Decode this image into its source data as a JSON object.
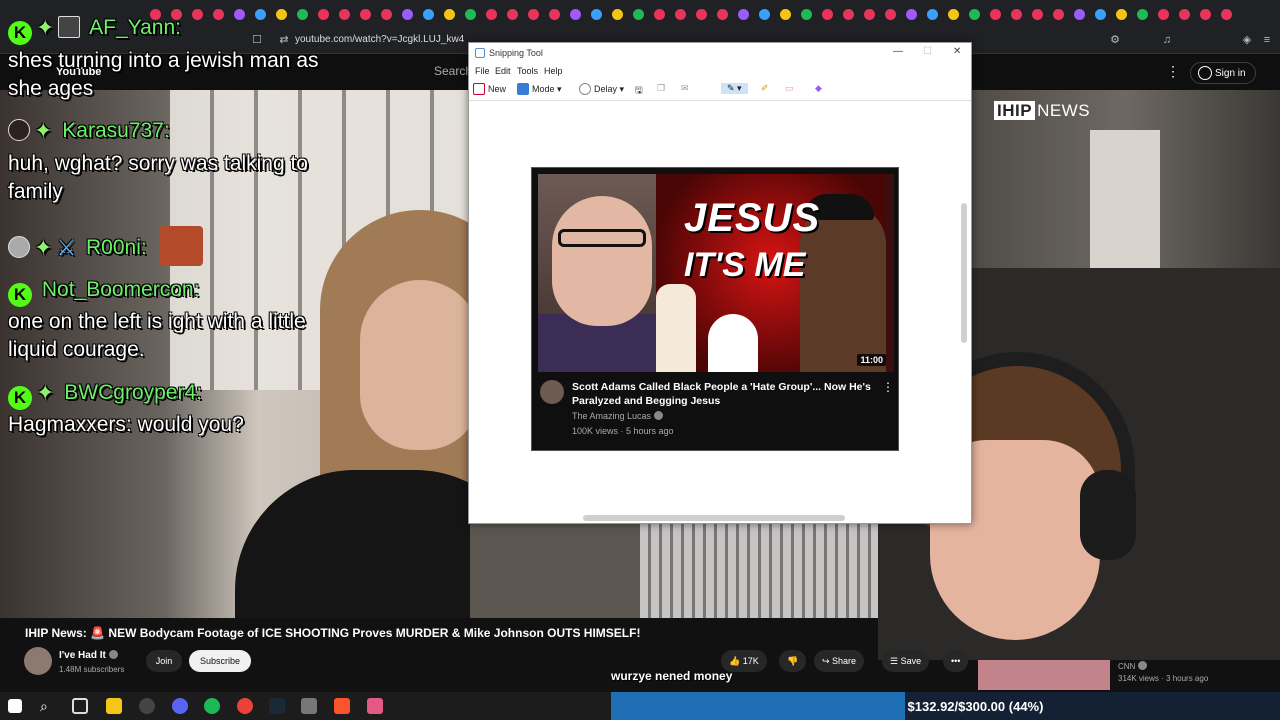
{
  "browser": {
    "url": "youtube.com/watch?v=Jcgkl.LUJ_kw4"
  },
  "youtube": {
    "logo_text": "YouTube",
    "search_placeholder": "Search",
    "sign_in_label": "Sign in"
  },
  "video_overlay": {
    "channel_logo_box": "IHIP",
    "channel_logo_rest": "NEWS"
  },
  "chat": [
    {
      "user": "AF_Yann:",
      "message": "shes turning into a jewish man as she ages"
    },
    {
      "user": "Karasu737:",
      "message": "huh, wghat? sorry was talking to family"
    },
    {
      "user": "R00ni:",
      "message": ""
    },
    {
      "user": "Not_Boomercon:",
      "message": "one on the left is ight with a little liquid courage."
    },
    {
      "user": "BWCgroyper4:",
      "message": "Hagmaxxers: would you?"
    }
  ],
  "snipping_tool": {
    "title": "Snipping Tool",
    "menu": [
      "File",
      "Edit",
      "Tools",
      "Help"
    ],
    "toolbar": {
      "new_label": "New",
      "mode_label": "Mode",
      "delay_label": "Delay"
    }
  },
  "captured_card": {
    "thumb_line1": "JESUS",
    "thumb_line2": "IT'S ME",
    "duration": "11:00",
    "title": "Scott Adams Called Black People a 'Hate Group'... Now He's Paralyzed and Begging Jesus",
    "channel": "The Amazing Lucas",
    "stats": "100K views · 5 hours ago"
  },
  "video_info": {
    "title": "IHIP News: 🚨 NEW Bodycam Footage of ICE SHOOTING Proves MURDER & Mike Johnson OUTS HIMSELF!",
    "channel_name": "I've Had It",
    "subscribers": "1.48M subscribers",
    "join_label": "Join",
    "subscribe_label": "Subscribe",
    "likes": "17K",
    "share_label": "Share",
    "save_label": "Save",
    "caption_text": "wurzye nened money"
  },
  "side_video": {
    "channel": "CNN",
    "stats": "314K views · 3 hours ago"
  },
  "donation": {
    "text": "$132.92/$300.00 (44%)",
    "progress_fraction": 0.44
  },
  "colors": {
    "chat_username": "#6ef06a",
    "kick_green": "#53fc18",
    "youtube_bg": "#0f0f0f",
    "donation_fill": "#1e6fb4"
  }
}
